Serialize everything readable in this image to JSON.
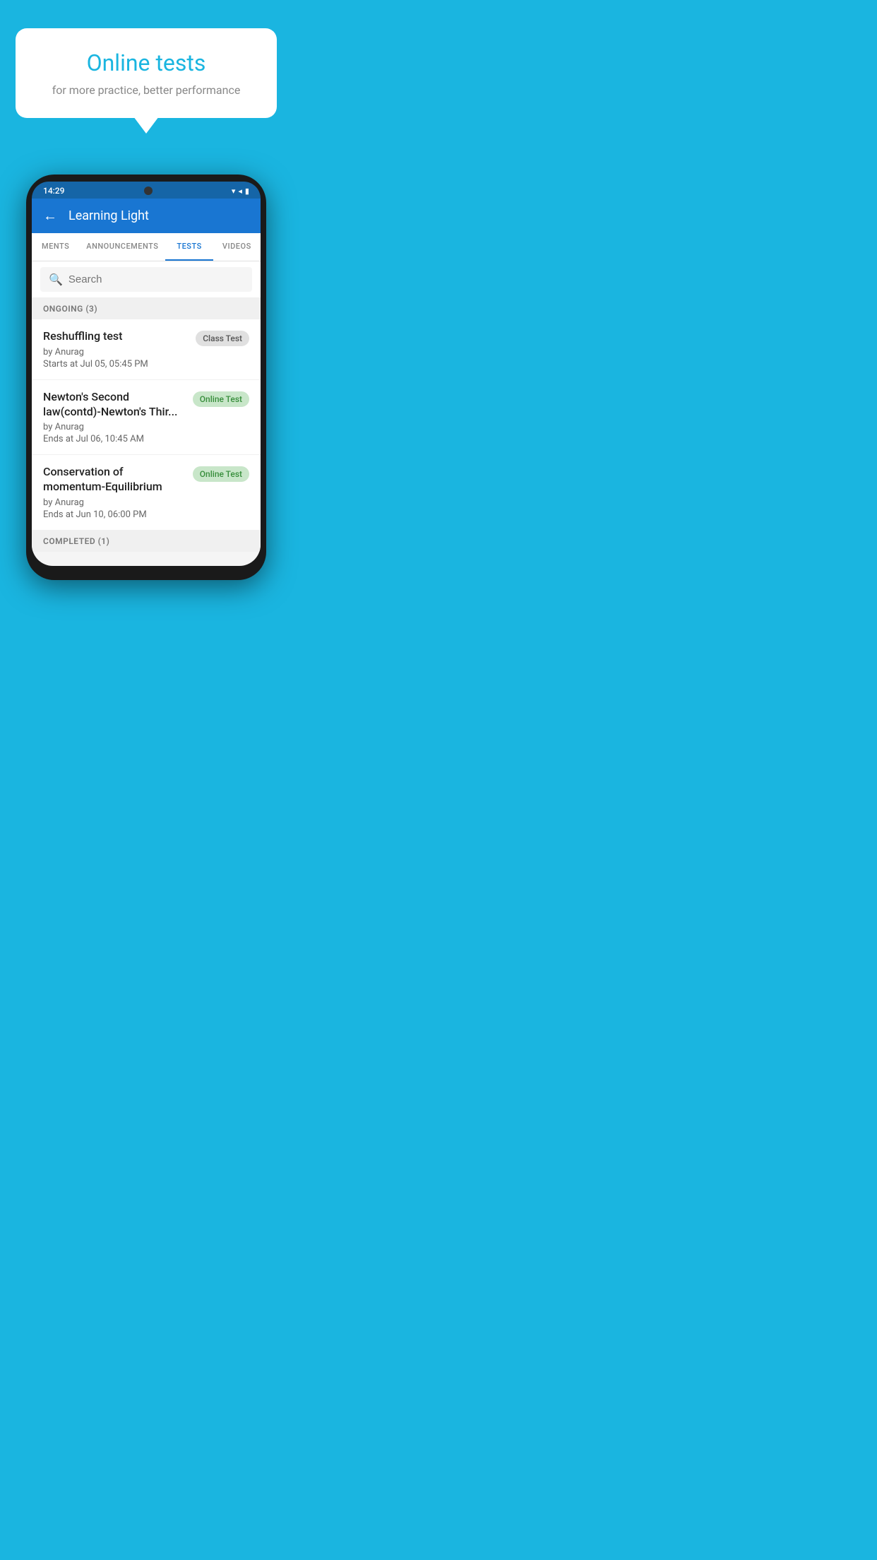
{
  "background": {
    "color": "#1ab5e0"
  },
  "bubble": {
    "title": "Online tests",
    "subtitle": "for more practice, better performance"
  },
  "phone": {
    "status_bar": {
      "time": "14:29",
      "icons": [
        "▼",
        "◀",
        "▮"
      ]
    },
    "app_bar": {
      "title": "Learning Light",
      "back_icon": "←"
    },
    "tabs": [
      {
        "label": "MENTS",
        "active": false
      },
      {
        "label": "ANNOUNCEMENTS",
        "active": false
      },
      {
        "label": "TESTS",
        "active": true
      },
      {
        "label": "VIDEOS",
        "active": false
      }
    ],
    "search": {
      "placeholder": "Search",
      "icon": "🔍"
    },
    "section_ongoing": {
      "label": "ONGOING (3)"
    },
    "tests": [
      {
        "title": "Reshuffling test",
        "author": "by Anurag",
        "date": "Starts at  Jul 05, 05:45 PM",
        "badge": "Class Test",
        "badge_type": "class"
      },
      {
        "title": "Newton's Second law(contd)-Newton's Thir...",
        "author": "by Anurag",
        "date": "Ends at  Jul 06, 10:45 AM",
        "badge": "Online Test",
        "badge_type": "online"
      },
      {
        "title": "Conservation of momentum-Equilibrium",
        "author": "by Anurag",
        "date": "Ends at  Jun 10, 06:00 PM",
        "badge": "Online Test",
        "badge_type": "online"
      }
    ],
    "section_completed": {
      "label": "COMPLETED (1)"
    }
  }
}
